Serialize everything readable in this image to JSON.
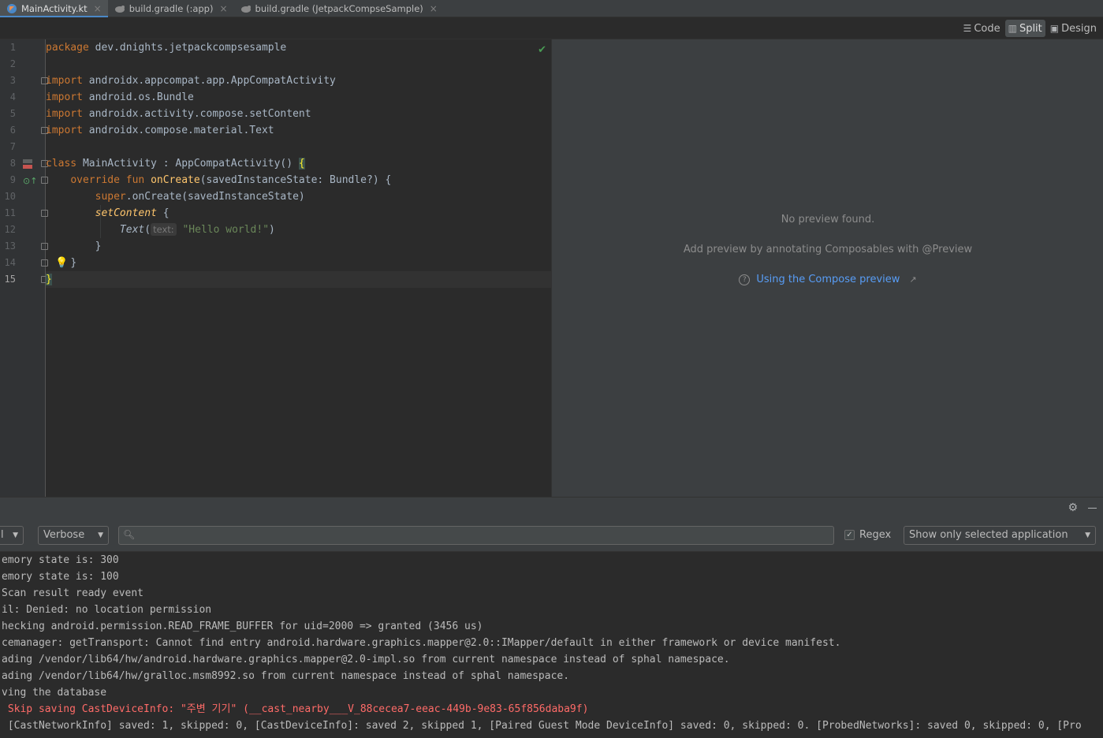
{
  "tabs": [
    {
      "label": "MainActivity.kt",
      "icon": "kotlin-file-icon",
      "active": true
    },
    {
      "label": "build.gradle (:app)",
      "icon": "gradle-icon",
      "active": false
    },
    {
      "label": "build.gradle (JetpackCompseSample)",
      "icon": "gradle-icon",
      "active": false
    }
  ],
  "view_modes": {
    "code": "Code",
    "split": "Split",
    "design": "Design",
    "selected": "Split"
  },
  "editor": {
    "line_numbers": [
      "1",
      "2",
      "3",
      "4",
      "5",
      "6",
      "7",
      "8",
      "9",
      "10",
      "11",
      "12",
      "13",
      "14",
      "15"
    ],
    "current_line": "15",
    "lines": {
      "l1_kw": "package",
      "l1_rest": " dev.dnights.jetpackcompsesample",
      "l3_kw": "import",
      "l3_rest": " androidx.appcompat.app.AppCompatActivity",
      "l4_kw": "import",
      "l4_rest": " android.os.Bundle",
      "l5_kw": "import",
      "l5_rest": " androidx.activity.compose.setContent",
      "l6_kw": "import",
      "l6_rest": " androidx.compose.material.Text",
      "l8_kw": "class",
      "l8_rest": " MainActivity : AppCompatActivity() ",
      "l8_brace": "{",
      "l9_kw": "override fun",
      "l9_fn": "onCreate",
      "l9_rest": "(savedInstanceState: Bundle?) {",
      "l10_kw": "super",
      "l10_rest": ".onCreate(savedInstanceState)",
      "l11_fn": "setContent",
      "l11_rest": " {",
      "l12_fn": "Text",
      "l12_open": "(",
      "l12_hint": "text:",
      "l12_str": "\"Hello world!\"",
      "l12_close": ")",
      "l13_rest": "}",
      "l14_rest": "}",
      "l15_rest": "}"
    }
  },
  "preview": {
    "no_preview": "No preview found.",
    "hint": "Add preview by annotating Composables with @Preview",
    "link": "Using the Compose preview",
    "link_arrow": "↗"
  },
  "logcat": {
    "process_combo": "",
    "level": "Verbose",
    "search_value": "",
    "regex_label": "Regex",
    "regex_checked": true,
    "filter": "Show only selected application",
    "lines": [
      {
        "text": "emory state is: 300",
        "type": "info"
      },
      {
        "text": "emory state is: 100",
        "type": "info"
      },
      {
        "text": "Scan result ready event",
        "type": "info"
      },
      {
        "text": "il: Denied: no location permission",
        "type": "info"
      },
      {
        "text": "hecking android.permission.READ_FRAME_BUFFER for uid=2000 => granted (3456 us)",
        "type": "info"
      },
      {
        "text": "cemanager: getTransport: Cannot find entry android.hardware.graphics.mapper@2.0::IMapper/default in either framework or device manifest.",
        "type": "info"
      },
      {
        "text": "ading /vendor/lib64/hw/android.hardware.graphics.mapper@2.0-impl.so from current namespace instead of sphal namespace.",
        "type": "info"
      },
      {
        "text": "ading /vendor/lib64/hw/gralloc.msm8992.so from current namespace instead of sphal namespace.",
        "type": "info"
      },
      {
        "text": "ving the database",
        "type": "info"
      },
      {
        "text": " Skip saving CastDeviceInfo: \"주변 기기\" (__cast_nearby___V_88cecea7-eeac-449b-9e83-65f856daba9f)",
        "type": "error"
      },
      {
        "text": " [CastNetworkInfo] saved: 1, skipped: 0, [CastDeviceInfo]: saved 2, skipped 1, [Paired Guest Mode DeviceInfo] saved: 0, skipped: 0. [ProbedNetworks]: saved 0, skipped: 0, [Pro",
        "type": "info"
      }
    ]
  },
  "colors": {
    "accent": "#4a88c7",
    "keyword": "#cc7832",
    "function": "#ffc66d",
    "string": "#6a8759",
    "error": "#ff6b68",
    "link": "#589df6"
  }
}
